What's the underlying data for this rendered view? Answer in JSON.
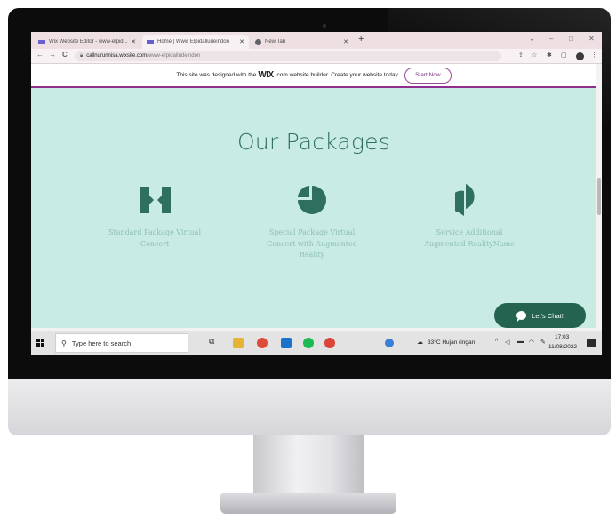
{
  "browser": {
    "tabs": [
      {
        "label": "Wix Website Editor - www-elpid..."
      },
      {
        "label": "Home | Www Elpidalludeindon"
      },
      {
        "label": "New Tab"
      }
    ],
    "new_tab_glyph": "+",
    "window_controls": {
      "chevron": "⌄",
      "minimize": "–",
      "maximize": "□",
      "close": "✕"
    },
    "nav": {
      "back": "←",
      "forward": "→",
      "reload": "C"
    },
    "address": {
      "domain": "callnurunnisa.wixsite.com",
      "path": "/www-elpidalludeindon"
    },
    "icons": [
      "share-icon",
      "star-icon",
      "extensions-icon",
      "sidebar-icon",
      "profile-icon",
      "menu-icon"
    ]
  },
  "wix_banner": {
    "text_before": "This site was designed with the",
    "logo_text": "WIX",
    "text_after": ".com website builder. Create your website today.",
    "button": "Start Now"
  },
  "site": {
    "background": "#c8ebe3",
    "title": "Our Packages",
    "packages": [
      {
        "icon": "bowtie-shape-icon",
        "lines": [
          "Standard Package Virtual",
          "Concert"
        ]
      },
      {
        "icon": "pie-shape-icon",
        "lines": [
          "Special Package Virtual",
          "Concert with Augmented",
          "Reality"
        ]
      },
      {
        "icon": "leaf-shape-icon",
        "lines": [
          "Service  Additional",
          "Augmented RealityName"
        ]
      }
    ],
    "chat_button": "Let's Chat!"
  },
  "taskbar": {
    "search_placeholder": "Type here to search",
    "apps": [
      "task-view-icon",
      "file-explorer-icon",
      "chrome-icon",
      "mail-icon",
      "spotify-icon",
      "chrome-icon"
    ],
    "weather": "33°C  Hujan ringan",
    "time": "17:03",
    "date": "11/08/2022"
  },
  "colors": {
    "accent_green": "#2f6f60",
    "chat_green": "#24634f",
    "wix_purple": "#8e2f8f"
  }
}
